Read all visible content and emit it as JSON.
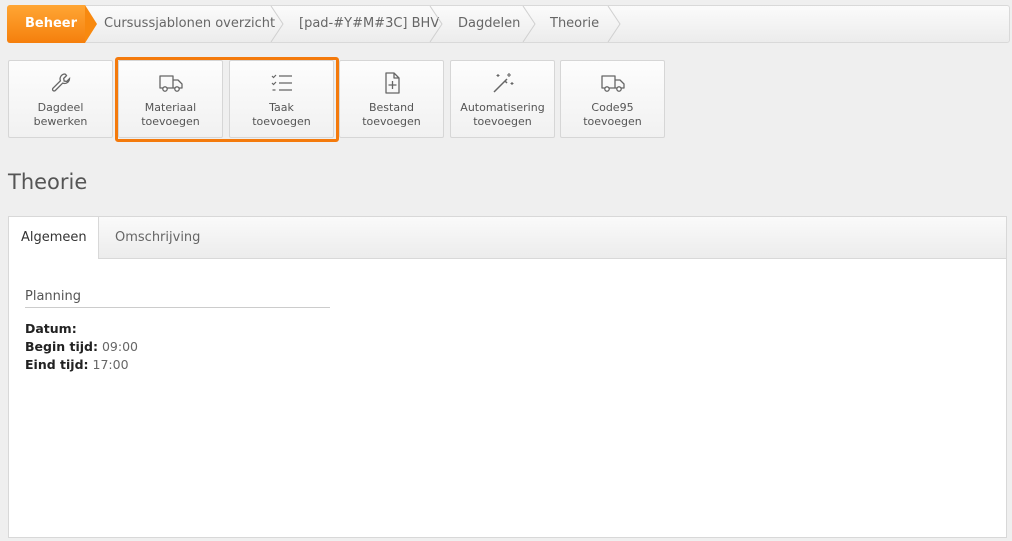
{
  "breadcrumb": {
    "items": [
      "Beheer",
      "Cursussjablonen overzicht",
      "[pad-#Y#M#3C] BHV",
      "Dagdelen",
      "Theorie"
    ]
  },
  "toolbar": {
    "buttons": [
      {
        "line1": "Dagdeel",
        "line2": "bewerken",
        "icon": "wrench-icon"
      },
      {
        "line1": "Materiaal",
        "line2": "toevoegen",
        "icon": "truck-icon"
      },
      {
        "line1": "Taak",
        "line2": "toevoegen",
        "icon": "checklist-icon"
      },
      {
        "line1": "Bestand",
        "line2": "toevoegen",
        "icon": "file-plus-icon"
      },
      {
        "line1": "Automatisering",
        "line2": "toevoegen",
        "icon": "magic-wand-icon"
      },
      {
        "line1": "Code95",
        "line2": "toevoegen",
        "icon": "truck-icon"
      }
    ],
    "highlight_color": "#f47a0c"
  },
  "page": {
    "title": "Theorie"
  },
  "tabs": [
    {
      "label": "Algemeen",
      "active": true
    },
    {
      "label": "Omschrijving",
      "active": false
    }
  ],
  "planning": {
    "title": "Planning",
    "datum_label": "Datum:",
    "datum_value": "",
    "begin_label": "Begin tijd:",
    "begin_value": "09:00",
    "eind_label": "Eind tijd:",
    "eind_value": "17:00"
  }
}
